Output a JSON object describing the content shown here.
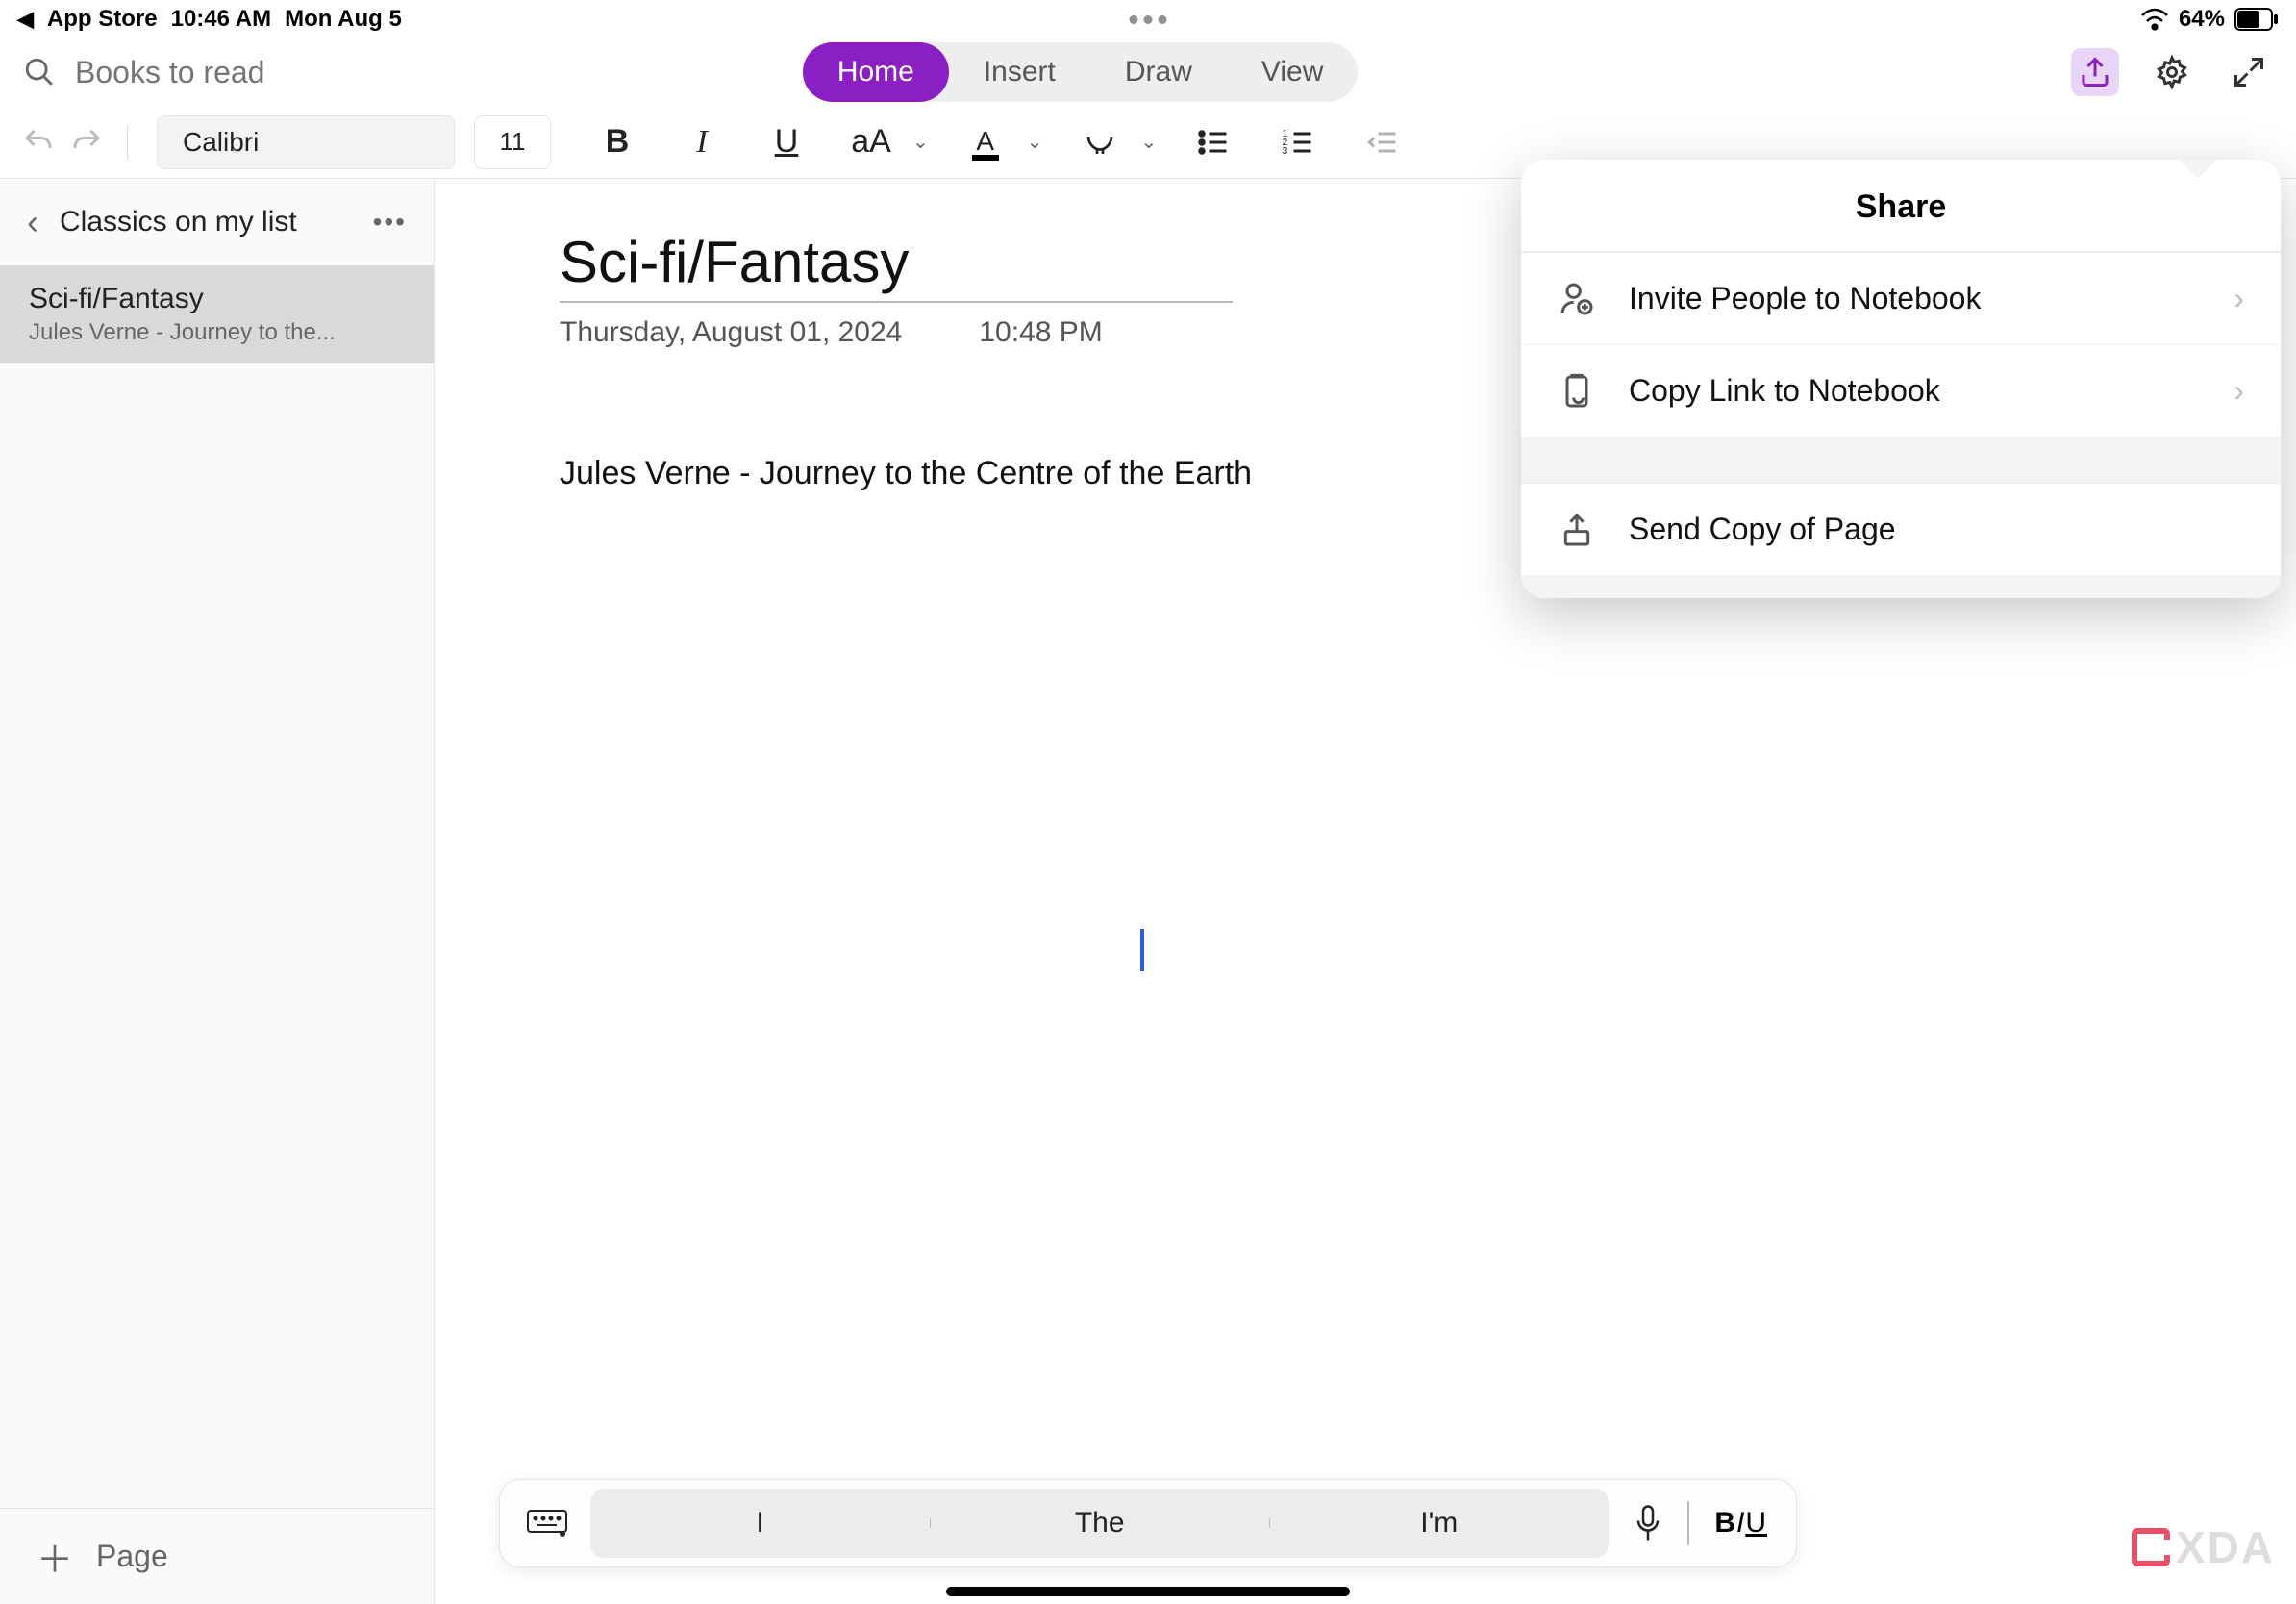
{
  "status": {
    "back_app": "App Store",
    "time": "10:46 AM",
    "date": "Mon Aug 5",
    "battery_pct": "64%"
  },
  "search": {
    "placeholder": "Books to read"
  },
  "tabs": {
    "home": "Home",
    "insert": "Insert",
    "draw": "Draw",
    "view": "View"
  },
  "format": {
    "font_name": "Calibri",
    "font_size": "11"
  },
  "sidebar": {
    "section": "Classics on my list",
    "add_page": "Page",
    "pages": [
      {
        "title": "Sci-fi/Fantasy",
        "snippet": "Jules Verne - Journey to the..."
      }
    ]
  },
  "note": {
    "title": "Sci-fi/Fantasy",
    "date": "Thursday, August 01, 2024",
    "time": "10:48 PM",
    "body": "Jules Verne - Journey to the Centre of the Earth"
  },
  "share": {
    "title": "Share",
    "invite": "Invite People to Notebook",
    "copy_link": "Copy Link to Notebook",
    "send_copy": "Send Copy of Page"
  },
  "kbd": {
    "sug1": "I",
    "sug2": "The",
    "sug3": "I'm"
  },
  "watermark": "XDA"
}
